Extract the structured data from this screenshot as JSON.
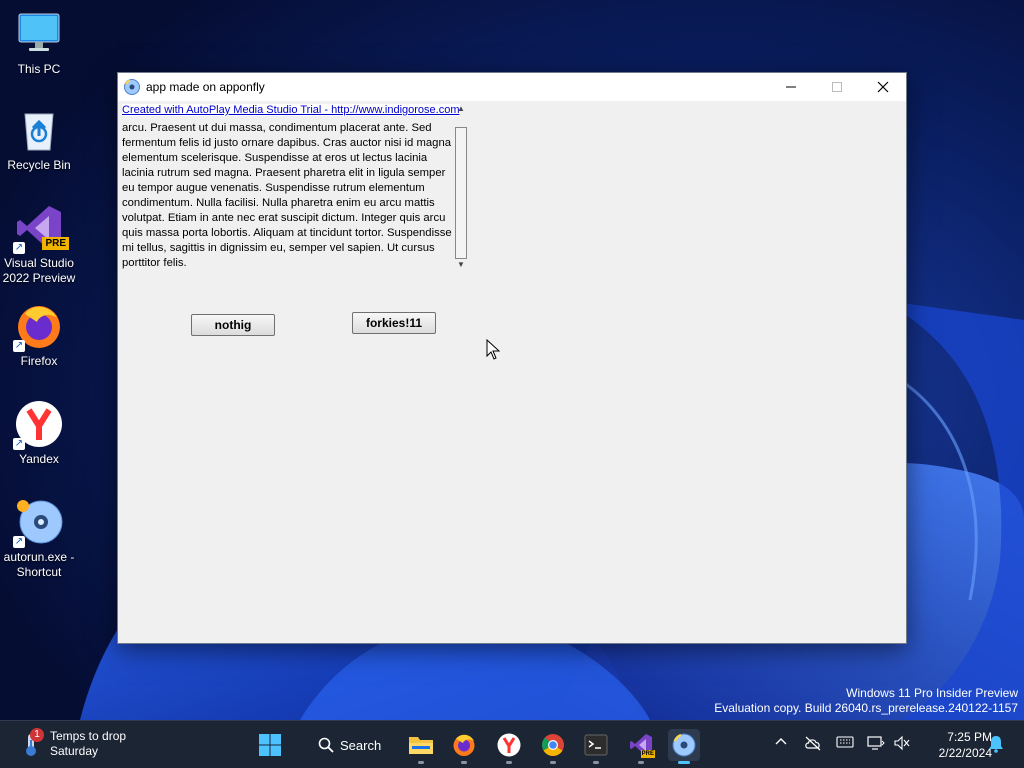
{
  "desktop": {
    "icons": [
      {
        "label": "This PC"
      },
      {
        "label": "Recycle Bin"
      },
      {
        "label": "Visual Studio 2022 Preview",
        "badge": "PRE"
      },
      {
        "label": "Firefox"
      },
      {
        "label": "Yandex"
      },
      {
        "label": "autorun.exe - Shortcut"
      }
    ]
  },
  "watermark": {
    "line1": "Windows 11 Pro Insider Preview",
    "line2": "Evaluation copy. Build 26040.rs_prerelease.240122-1157"
  },
  "window": {
    "title": "app made on apponfly",
    "trial_link": "Created with AutoPlay Media Studio Trial - http://www.indigorose.com",
    "body_text": "arcu. Praesent ut dui massa, condimentum placerat ante. Sed fermentum felis id justo ornare dapibus. Cras auctor nisi id magna elementum scelerisque. Suspendisse at eros ut lectus lacinia lacinia rutrum sed magna. Praesent pharetra elit in ligula semper eu tempor augue venenatis. Suspendisse rutrum elementum condimentum. Nulla facilisi. Nulla pharetra enim eu arcu mattis volutpat. Etiam in ante nec erat suscipit dictum. Integer quis arcu quis massa porta lobortis. Aliquam at tincidunt tortor. Suspendisse mi tellus, sagittis in dignissim eu, semper vel sapien. Ut cursus porttitor felis.",
    "buttons": {
      "nothig": "nothig",
      "forkies": "forkies!11"
    }
  },
  "taskbar": {
    "weather": {
      "line1": "Temps to drop",
      "line2": "Saturday",
      "badge": "1"
    },
    "search_label": "Search",
    "clock": {
      "time": "7:25 PM",
      "date": "2/22/2024"
    },
    "vs_badge": "PRE"
  },
  "colors": {
    "taskbar": "#1c2534",
    "link": "#0000cc",
    "accent": "#4cc2ff",
    "window_bg": "#f0f0f0"
  }
}
